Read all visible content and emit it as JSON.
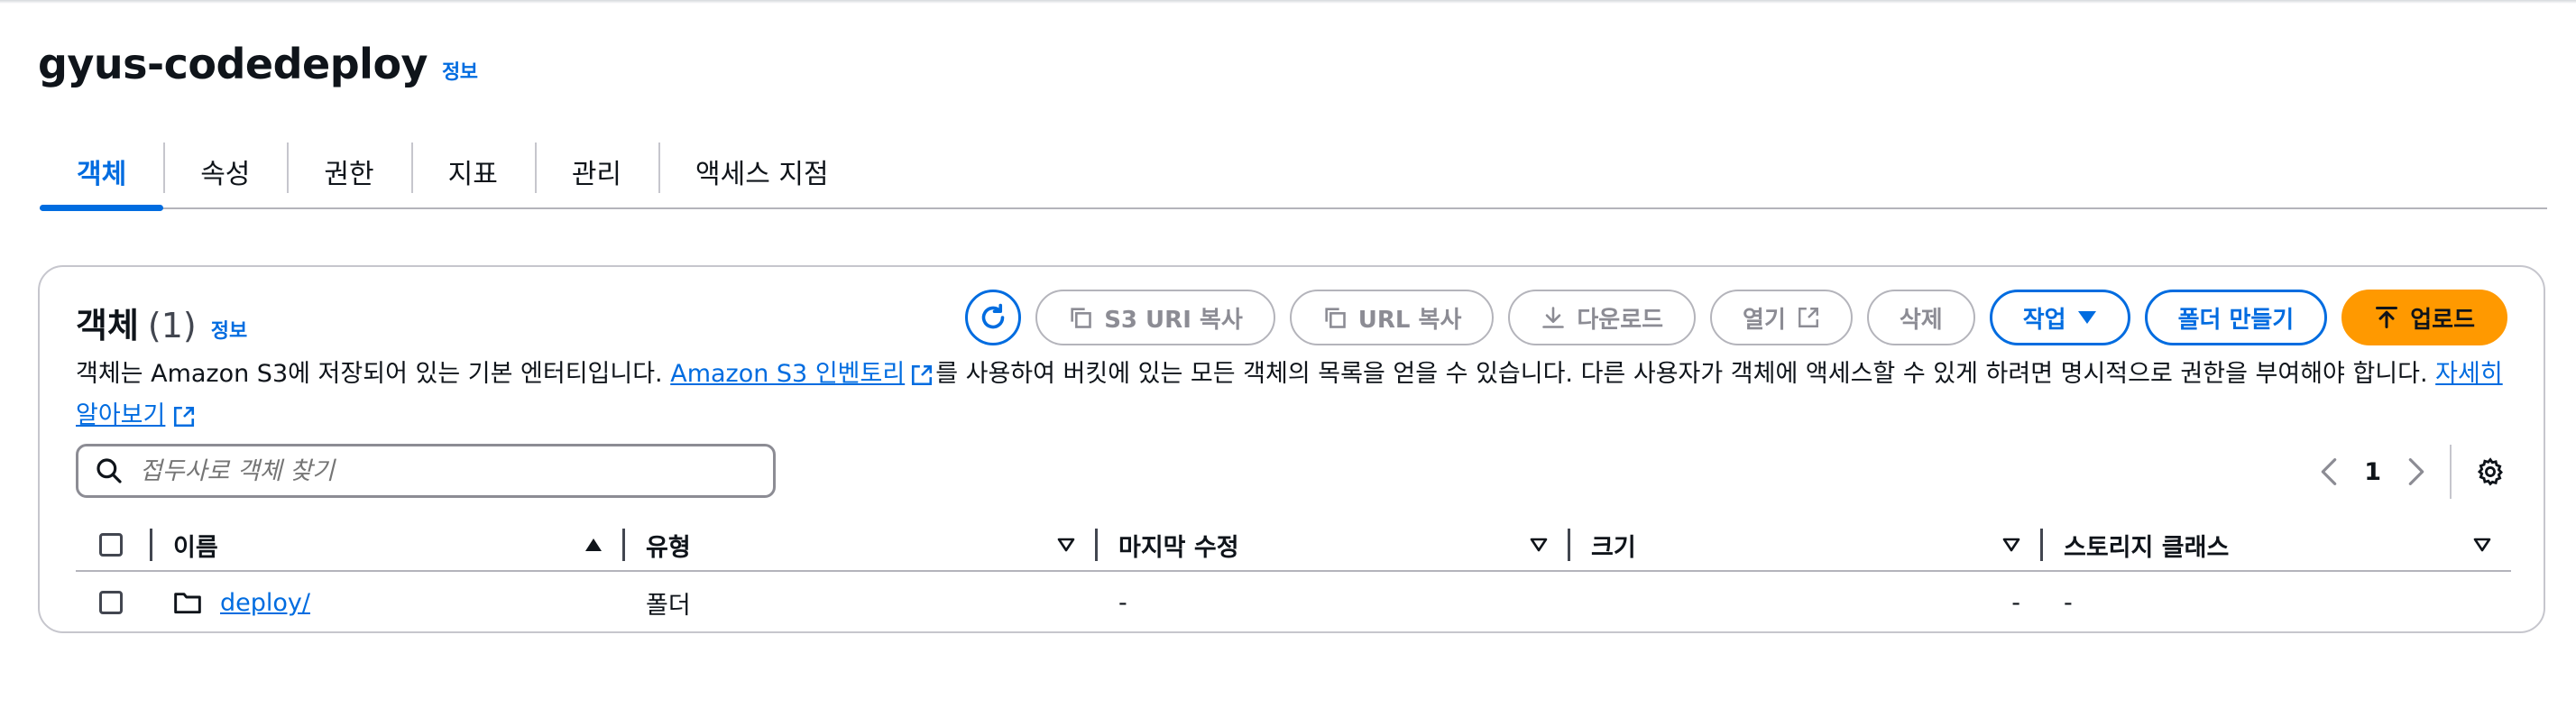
{
  "bucket": {
    "name": "gyus-codedeploy",
    "info": "정보"
  },
  "tabs": [
    {
      "label": "객체",
      "active": true
    },
    {
      "label": "속성"
    },
    {
      "label": "권한"
    },
    {
      "label": "지표"
    },
    {
      "label": "관리"
    },
    {
      "label": "액세스 지점"
    }
  ],
  "objects": {
    "title": "객체",
    "count": "(1)",
    "info": "정보",
    "description_1": "객체는 Amazon S3에 저장되어 있는 기본 엔터티입니다. ",
    "inventory_link": "Amazon S3 인벤토리",
    "description_2": "를 사용하여 버킷에 있는 모든 객체의 목록을 얻을 수 있습니다. 다른 사용자가 객체에 액세스할 수 있게 하려면 명시적으로 권한을 부여해야 합니다. ",
    "learn_more": "자세히 알아보기"
  },
  "toolbar": {
    "copy_s3_uri": "S3 URI 복사",
    "copy_url": "URL 복사",
    "download": "다운로드",
    "open": "열기",
    "delete": "삭제",
    "actions": "작업",
    "create_folder": "폴더 만들기",
    "upload": "업로드"
  },
  "search": {
    "placeholder": "접두사로 객체 찾기"
  },
  "pagination": {
    "current_page": "1"
  },
  "table": {
    "columns": [
      "이름",
      "유형",
      "마지막 수정",
      "크기",
      "스토리지 클래스"
    ],
    "rows": [
      {
        "name": "deploy/",
        "type": "폴더",
        "last_modified": "-",
        "size": "-",
        "storage_class": "-"
      }
    ]
  },
  "colors": {
    "accent": "#006ce0",
    "primary_button": "#ff9900",
    "disabled": "#8c8c94"
  }
}
